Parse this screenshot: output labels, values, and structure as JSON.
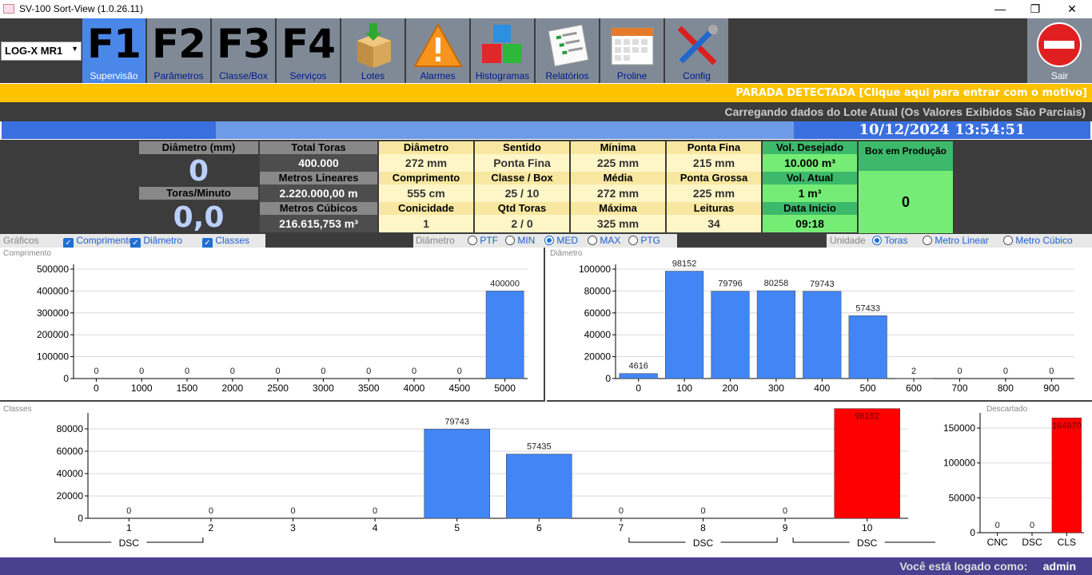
{
  "window": {
    "title": "SV-100 Sort-View (1.0.26.11)",
    "minimize": "—",
    "maximize": "❐",
    "close": "✕"
  },
  "toolbar": {
    "lote_select": "LOG-X MR1",
    "buttons": [
      {
        "key": "F1",
        "label": "Supervisão"
      },
      {
        "key": "F2",
        "label": "Parâmetros"
      },
      {
        "key": "F3",
        "label": "Classe/Box"
      },
      {
        "key": "F4",
        "label": "Serviços"
      }
    ],
    "icon_buttons": [
      {
        "label": "Lotes",
        "icon": "box-download-icon"
      },
      {
        "label": "Alarmes",
        "icon": "warning-icon"
      },
      {
        "label": "Histogramas",
        "icon": "cubes-icon"
      },
      {
        "label": "Relatórios",
        "icon": "report-icon"
      },
      {
        "label": "Proline",
        "icon": "calendar-icon"
      },
      {
        "label": "Config",
        "icon": "tools-icon"
      }
    ],
    "exit_label": "Sair"
  },
  "alert": "PARADA DETECTADA [Clique aqui para entrar com o motivo]",
  "loading": "Carregando dados do Lote Atual (Os Valores Exibidos São Parciais)",
  "progress": 0.27,
  "datetime": "10/12/2024 13:54:51",
  "info": {
    "diametro_mm_label": "Diâmetro (mm)",
    "diametro_mm": "0",
    "toras_min_label": "Toras/Minuto",
    "toras_min": "0,0",
    "total_toras_label": "Total Toras",
    "total_toras": "400.000",
    "metros_lineares_label": "Metros Lineares",
    "metros_lineares": "2.220.000,00 m",
    "metros_cubicos_label": "Metros Cúbicos",
    "metros_cubicos": "216.615,753 m³",
    "grid": [
      [
        {
          "h": "Diâmetro",
          "v": "272 mm"
        },
        {
          "h": "Sentido",
          "v": "Ponta Fina"
        },
        {
          "h": "Mínima",
          "v": "225 mm"
        },
        {
          "h": "Ponta Fina",
          "v": "215 mm"
        }
      ],
      [
        {
          "h": "Comprimento",
          "v": "555 cm"
        },
        {
          "h": "Classe / Box",
          "v": "25 / 10"
        },
        {
          "h": "Média",
          "v": "272 mm"
        },
        {
          "h": "Ponta Grossa",
          "v": "225 mm"
        }
      ],
      [
        {
          "h": "Conicidade",
          "v": "1"
        },
        {
          "h": "Qtd Toras",
          "v": "2 / 0"
        },
        {
          "h": "Máxima",
          "v": "325 mm"
        },
        {
          "h": "Leituras",
          "v": "34"
        }
      ]
    ],
    "green": [
      {
        "h": "Vol. Desejado",
        "v": "10.000 m³"
      },
      {
        "h": "Vol. Atual",
        "v": "1 m³"
      },
      {
        "h": "Data Inicio",
        "v": "09:18"
      }
    ],
    "box_producao_label": "Box em Produção",
    "box_producao": "0"
  },
  "options": {
    "graficos_label": "Gráficos",
    "graficos": [
      "Comprimento",
      "Diâmetro",
      "Classes"
    ],
    "diametro_label": "Diâmetro",
    "diametro_opts": [
      "PTF",
      "MIN",
      "MED",
      "MAX",
      "PTG"
    ],
    "diametro_selected": "MED",
    "unidade_label": "Unidade",
    "unidade_opts": [
      "Toras",
      "Metro Linear",
      "Metro Cúbico"
    ],
    "unidade_selected": "Toras"
  },
  "status": {
    "label": "Você está logado como:",
    "user": "admin"
  },
  "chart_data": [
    {
      "type": "bar",
      "title": "Comprimento",
      "categories": [
        "0",
        "1000",
        "1500",
        "2000",
        "2500",
        "3000",
        "3500",
        "4000",
        "4500",
        "5000"
      ],
      "values": [
        0,
        0,
        0,
        0,
        0,
        0,
        0,
        0,
        0,
        400000
      ],
      "ylim": [
        0,
        500000
      ],
      "yticks": [
        0,
        100000,
        200000,
        300000,
        400000,
        500000
      ],
      "color": "#4285f4"
    },
    {
      "type": "bar",
      "title": "Diâmetro",
      "categories": [
        "0",
        "100",
        "200",
        "300",
        "400",
        "500",
        "600",
        "700",
        "800",
        "900"
      ],
      "values": [
        4616,
        98152,
        79796,
        80258,
        79743,
        57433,
        2,
        0,
        0,
        0
      ],
      "ylim": [
        0,
        100000
      ],
      "yticks": [
        0,
        20000,
        40000,
        60000,
        80000,
        100000
      ],
      "color": "#4285f4"
    },
    {
      "type": "bar",
      "title": "Classes",
      "categories": [
        "1",
        "2",
        "3",
        "4",
        "5",
        "6",
        "7",
        "8",
        "9",
        "10"
      ],
      "values": [
        0,
        0,
        0,
        0,
        79743,
        57435,
        0,
        0,
        0,
        98152
      ],
      "colors": [
        "#4285f4",
        "#4285f4",
        "#4285f4",
        "#4285f4",
        "#4285f4",
        "#4285f4",
        "#4285f4",
        "#4285f4",
        "#4285f4",
        "#ff0000"
      ],
      "ylim": [
        0,
        90000
      ],
      "yticks": [
        0,
        20000,
        40000,
        60000,
        80000
      ],
      "groups": [
        {
          "label": "DSC",
          "from": 0,
          "to": 0
        },
        {
          "label": "DSC",
          "from": 7,
          "to": 7
        },
        {
          "label": "DSC",
          "from": 9,
          "to": 9
        }
      ]
    },
    {
      "type": "bar",
      "title": "Descartado",
      "categories": [
        "CNC",
        "DSC",
        "CLS"
      ],
      "values": [
        0,
        0,
        164670
      ],
      "colors": [
        "#4285f4",
        "#4285f4",
        "#ff0000"
      ],
      "ylim": [
        0,
        165000
      ],
      "yticks": [
        0,
        50000,
        100000,
        150000
      ]
    }
  ]
}
